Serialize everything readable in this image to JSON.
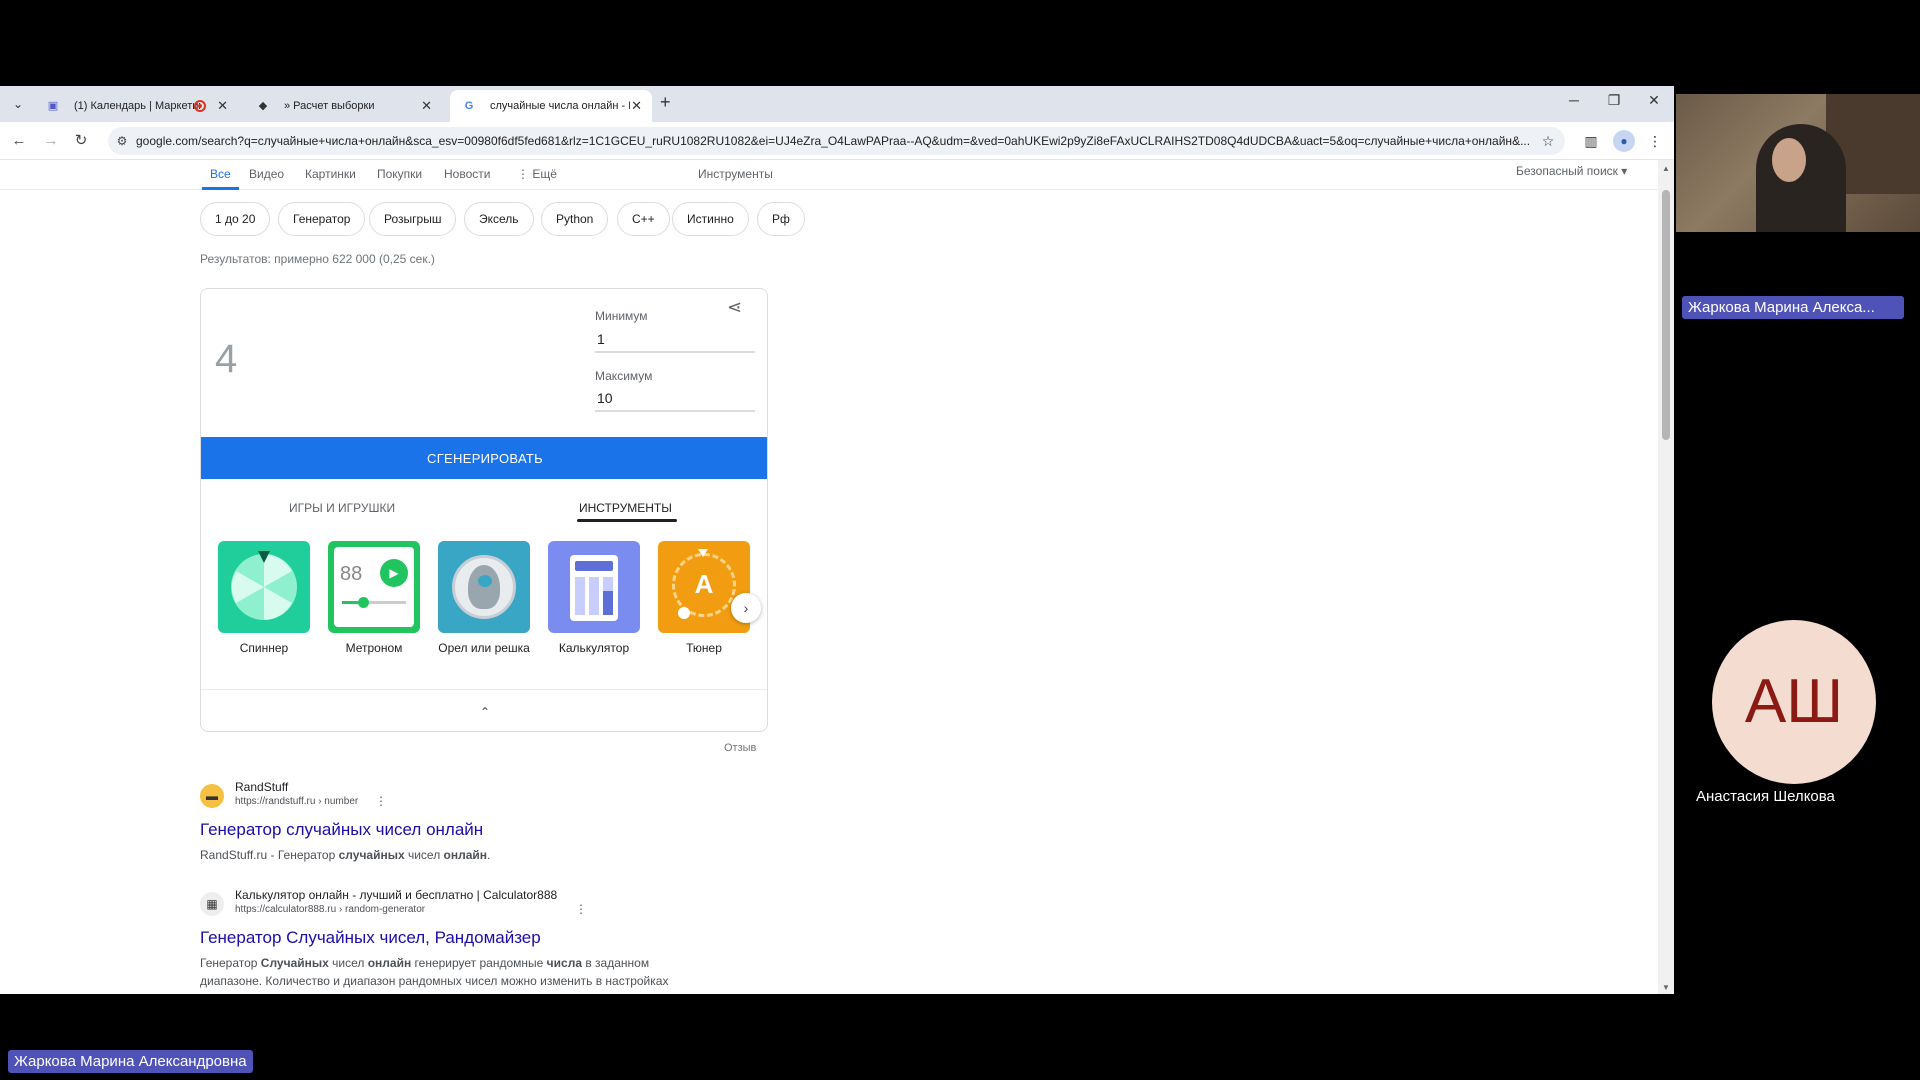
{
  "tabs": [
    {
      "title": "(1) Календарь | Маркетин",
      "icon": "teams-icon"
    },
    {
      "title": "» Расчет выборки",
      "icon": "shield-icon"
    },
    {
      "title": "случайные числа онлайн - П",
      "icon": "google-icon"
    }
  ],
  "toolbar": {
    "url": "google.com/search?q=случайные+числа+онлайн&sca_esv=00980f6df5fed681&rlz=1C1GCEU_ruRU1082RU1082&ei=UJ4eZra_O4LawPAPraa--AQ&udm=&ved=0ahUKEwi2p9yZi8eFAxUCLRAIHS2TD08Q4dUDCBA&uact=5&oq=случайные+числа+онлайн&..."
  },
  "search_tabs": {
    "all": "Все",
    "video": "Видео",
    "images": "Картинки",
    "shopping": "Покупки",
    "news": "Новости",
    "more": "Ещё",
    "tools": "Инструменты",
    "safesearch": "Безопасный поиск"
  },
  "chips": [
    "1 до 20",
    "Генератор",
    "Розыгрыш",
    "Эксель",
    "Python",
    "C++",
    "Истинно",
    "Рф"
  ],
  "results_count": "Результатов: примерно 622 000 (0,25 сек.)",
  "rng": {
    "result": "4",
    "min_label": "Минимум",
    "min_value": "1",
    "max_label": "Максимум",
    "max_value": "10",
    "generate_label": "СГЕНЕРИРОВАТЬ",
    "cat_games": "ИГРЫ И ИГРУШКИ",
    "cat_tools": "ИНСТРУМЕНТЫ",
    "tools": [
      {
        "label": "Спиннер",
        "color": "#1fce9a"
      },
      {
        "label": "Метроном",
        "color": "#21c45e",
        "text": "88"
      },
      {
        "label": "Орел или решка",
        "color": "#39a6c6"
      },
      {
        "label": "Калькулятор",
        "color": "#7b8cf0"
      },
      {
        "label": "Тюнер",
        "color": "#f29d11",
        "text": "A"
      }
    ],
    "feedback": "Отзыв"
  },
  "results": [
    {
      "site": "RandStuff",
      "cite": "https://randstuff.ru › number",
      "title": "Генератор случайных чисел онлайн",
      "snippet_parts": [
        "RandStuff.ru - Генератор ",
        "случайных",
        " чисел ",
        "онлайн",
        "."
      ]
    },
    {
      "site": "Калькулятор онлайн - лучший и бесплатно | Calculator888",
      "cite": "https://calculator888.ru › random-generator",
      "title": "Генератор Случайных чисел, Рандомайзер",
      "snippet_line1_parts": [
        "Генератор ",
        "Случайных",
        " чисел ",
        "онлайн",
        " генерирует рандомные ",
        "числа",
        " в заданном"
      ],
      "snippet_line2": "диапазоне. Количество и диапазон рандомных чисел можно изменить в настройках"
    }
  ],
  "call": {
    "speaker_tag": "Жаркова Марина Алекса...",
    "avatar_initials": "АШ",
    "participant_name": "Анастасия Шелкова",
    "bottom_tag": "Жаркова Марина Александровна"
  },
  "colors": {
    "accent": "#1a73e8",
    "link": "#1a0dab",
    "teams_tag": "#4f53b8"
  }
}
